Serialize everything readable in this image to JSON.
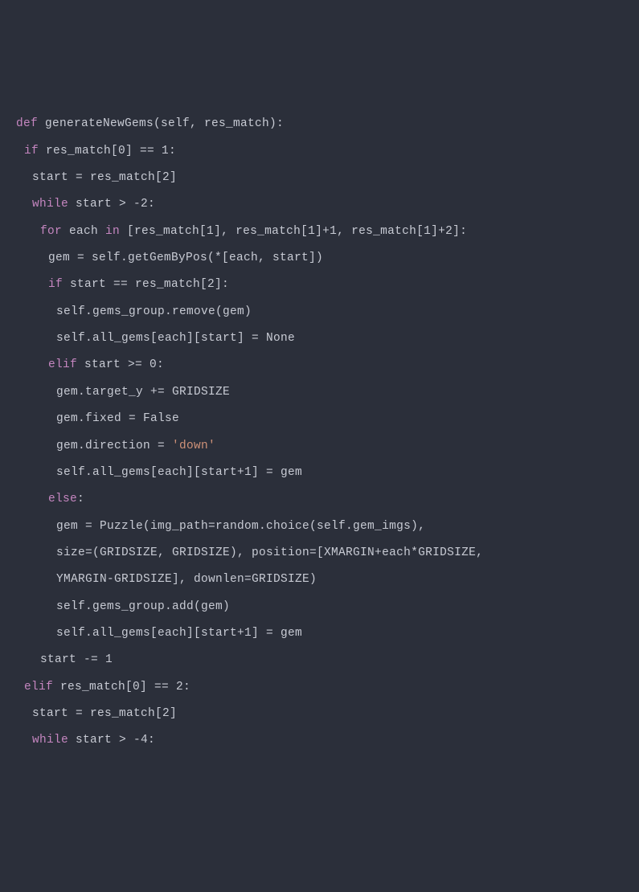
{
  "code": {
    "lines": [
      {
        "indent": 0,
        "tokens": [
          {
            "t": "def ",
            "c": "kw"
          },
          {
            "t": "generateNewGems(self, res_match):",
            "c": "id"
          }
        ]
      },
      {
        "indent": 1,
        "tokens": [
          {
            "t": "if ",
            "c": "kw"
          },
          {
            "t": "res_match[0] == 1:",
            "c": "id"
          }
        ]
      },
      {
        "indent": 2,
        "tokens": [
          {
            "t": "start = res_match[2]",
            "c": "id"
          }
        ]
      },
      {
        "indent": 2,
        "tokens": [
          {
            "t": "while ",
            "c": "kw"
          },
          {
            "t": "start > -2:",
            "c": "id"
          }
        ]
      },
      {
        "indent": 0,
        "tokens": [
          {
            "t": "",
            "c": "id"
          }
        ]
      },
      {
        "indent": 3,
        "tokens": [
          {
            "t": "for ",
            "c": "kw"
          },
          {
            "t": "each ",
            "c": "id"
          },
          {
            "t": "in ",
            "c": "kw"
          },
          {
            "t": "[res_match[1], res_match[1]+1, res_match[1]+2]:",
            "c": "id"
          }
        ]
      },
      {
        "indent": 4,
        "tokens": [
          {
            "t": "gem = self.getGemByPos(*[each, start])",
            "c": "id"
          }
        ]
      },
      {
        "indent": 4,
        "tokens": [
          {
            "t": "if ",
            "c": "kw"
          },
          {
            "t": "start == res_match[2]:",
            "c": "id"
          }
        ]
      },
      {
        "indent": 5,
        "tokens": [
          {
            "t": "self.gems_group.remove(gem)",
            "c": "id"
          }
        ]
      },
      {
        "indent": 5,
        "tokens": [
          {
            "t": "self.all_gems[each][start] = None",
            "c": "id"
          }
        ]
      },
      {
        "indent": 4,
        "tokens": [
          {
            "t": "elif ",
            "c": "kw"
          },
          {
            "t": "start >= 0:",
            "c": "id"
          }
        ]
      },
      {
        "indent": 5,
        "tokens": [
          {
            "t": "gem.target_y += GRIDSIZE",
            "c": "id"
          }
        ]
      },
      {
        "indent": 5,
        "tokens": [
          {
            "t": "gem.fixed = False",
            "c": "id"
          }
        ]
      },
      {
        "indent": 5,
        "tokens": [
          {
            "t": "gem.direction = ",
            "c": "id"
          },
          {
            "t": "'down'",
            "c": "str"
          }
        ]
      },
      {
        "indent": 5,
        "tokens": [
          {
            "t": "self.all_gems[each][start+1] = gem",
            "c": "id"
          }
        ]
      },
      {
        "indent": 4,
        "tokens": [
          {
            "t": "else",
            "c": "kw"
          },
          {
            "t": ":",
            "c": "id"
          }
        ]
      },
      {
        "indent": 5,
        "tokens": [
          {
            "t": "gem = Puzzle(img_path=random.choice(self.gem_imgs),",
            "c": "id"
          }
        ]
      },
      {
        "indent": 5,
        "tokens": [
          {
            "t": "size=(GRIDSIZE, GRIDSIZE), position=[XMARGIN+each*GRIDSIZE,",
            "c": "id"
          }
        ]
      },
      {
        "indent": 5,
        "tokens": [
          {
            "t": "YMARGIN-GRIDSIZE], downlen=GRIDSIZE)",
            "c": "id"
          }
        ]
      },
      {
        "indent": 5,
        "tokens": [
          {
            "t": "self.gems_group.add(gem)",
            "c": "id"
          }
        ]
      },
      {
        "indent": 5,
        "tokens": [
          {
            "t": "self.all_gems[each][start+1] = gem",
            "c": "id"
          }
        ]
      },
      {
        "indent": 3,
        "tokens": [
          {
            "t": "start -= 1",
            "c": "id"
          }
        ]
      },
      {
        "indent": 1,
        "tokens": [
          {
            "t": "elif ",
            "c": "kw"
          },
          {
            "t": "res_match[0] == 2:",
            "c": "id"
          }
        ]
      },
      {
        "indent": 2,
        "tokens": [
          {
            "t": "start = res_match[2]",
            "c": "id"
          }
        ]
      },
      {
        "indent": 2,
        "tokens": [
          {
            "t": "while ",
            "c": "kw"
          },
          {
            "t": "start > -4:",
            "c": "id"
          }
        ]
      }
    ],
    "indent_unit": " "
  }
}
